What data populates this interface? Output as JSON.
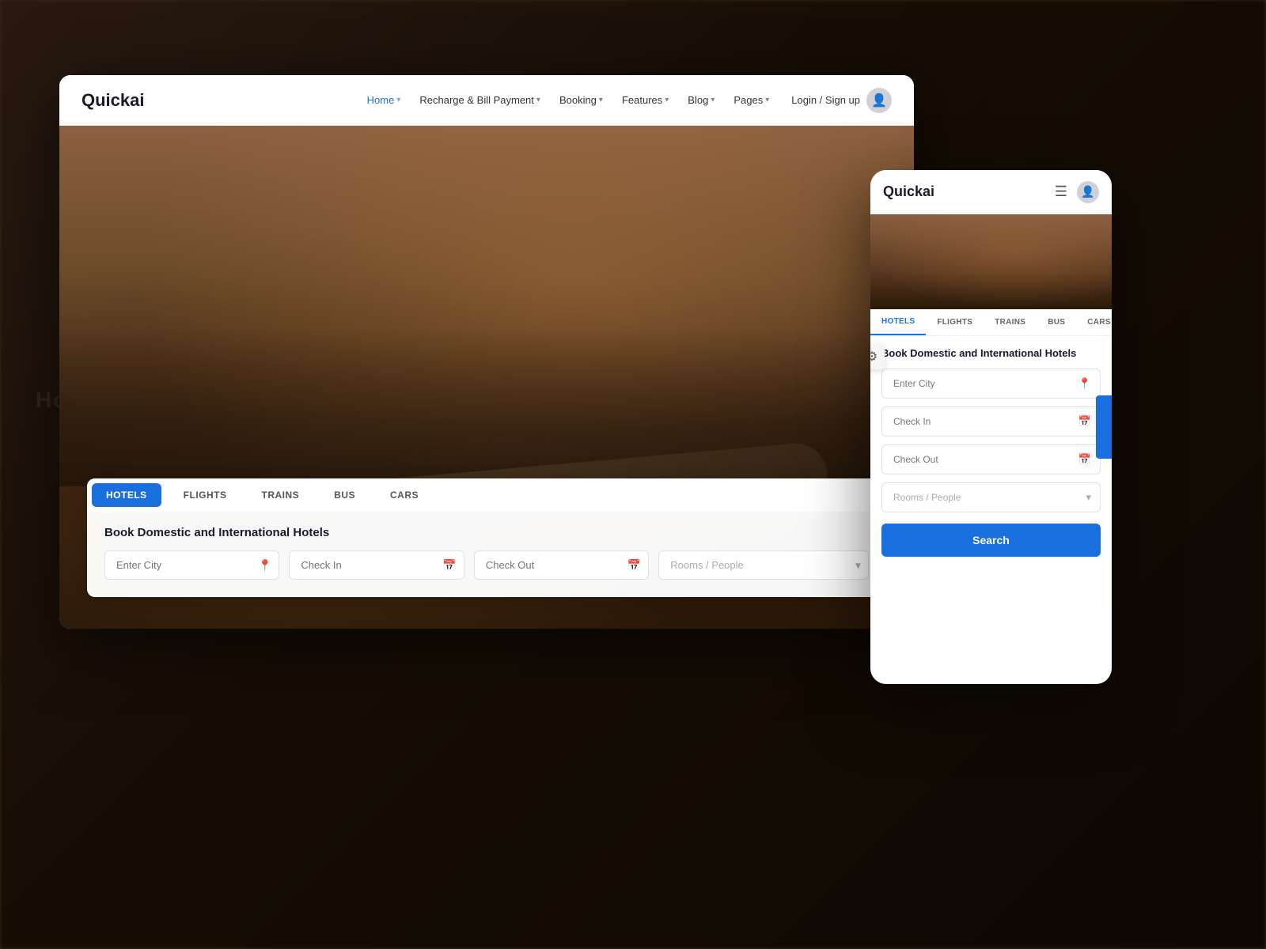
{
  "app": {
    "name": "Quickai"
  },
  "desktop": {
    "nav": {
      "logo": "Quickai",
      "links": [
        {
          "label": "Home",
          "active": true
        },
        {
          "label": "Recharge & Bill Payment",
          "active": false
        },
        {
          "label": "Booking",
          "active": false
        },
        {
          "label": "Features",
          "active": false
        },
        {
          "label": "Blog",
          "active": false
        },
        {
          "label": "Pages",
          "active": false
        }
      ],
      "login_label": "Login / Sign up"
    },
    "hero": {
      "search": {
        "title": "Book Domestic and International Hotels",
        "tabs": [
          "HOTELS",
          "FLIGHTS",
          "TRAINS",
          "BUS",
          "CARS"
        ],
        "active_tab": "HOTELS",
        "city_placeholder": "Enter City",
        "checkin_placeholder": "Check In",
        "checkout_placeholder": "Check Out",
        "rooms_placeholder": "Rooms / People"
      }
    }
  },
  "mobile": {
    "nav": {
      "logo": "Quickai"
    },
    "search": {
      "title": "Book Domestic and International Hotels",
      "tabs": [
        "HOTELS",
        "FLIGHTS",
        "TRAINS",
        "BUS",
        "CARS"
      ],
      "active_tab": "HOTELS",
      "city_placeholder": "Enter City",
      "checkin_placeholder": "Check In",
      "checkout_placeholder": "Check Out",
      "rooms_placeholder": "Rooms / People",
      "search_button": "Search"
    }
  },
  "bg_text": "Hotels"
}
